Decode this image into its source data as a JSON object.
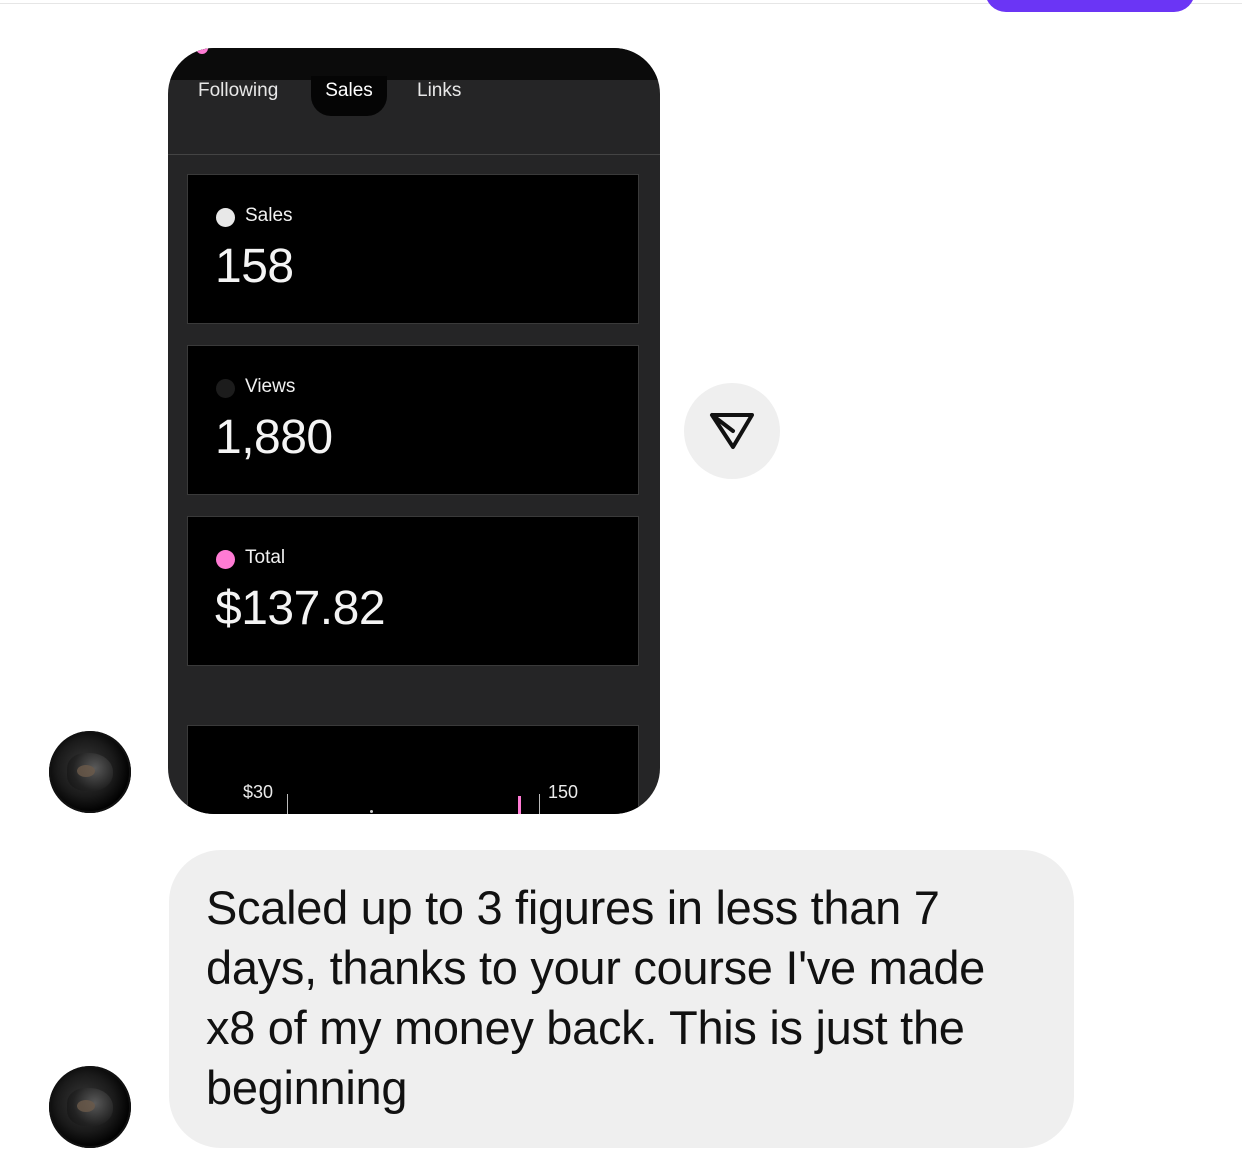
{
  "stats_screenshot": {
    "tabs": [
      "Following",
      "Sales",
      "Links"
    ],
    "active_tab": "Sales",
    "cards": [
      {
        "label": "Sales",
        "value": "158",
        "dot_color": "#e8e8e8"
      },
      {
        "label": "Views",
        "value": "1,880",
        "dot_color": "#1c1c1c"
      },
      {
        "label": "Total",
        "value": "$137.82",
        "dot_color": "#ff7bd4"
      }
    ],
    "chart": {
      "left_tick": "$30",
      "right_tick": "150"
    }
  },
  "share_button": {
    "icon": "send-icon"
  },
  "message": {
    "text": "Scaled up to 3 figures in less than 7 days, thanks to your course I've made x8 of my money back. This is just the beginning"
  },
  "colors": {
    "accent_purple": "#6b35f5",
    "bubble_bg": "#efefef",
    "phone_bg": "#252526",
    "total_dot": "#ff7bd4"
  }
}
